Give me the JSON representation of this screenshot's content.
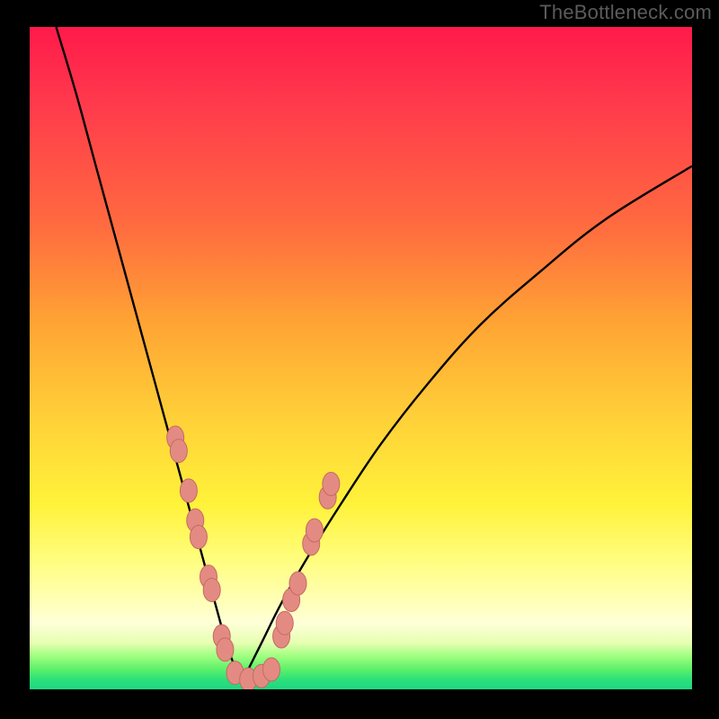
{
  "watermark": "TheBottleneck.com",
  "chart_data": {
    "type": "line",
    "title": "",
    "xlabel": "",
    "ylabel": "",
    "xlim": [
      0,
      100
    ],
    "ylim": [
      0,
      100
    ],
    "grid": false,
    "legend": false,
    "notes": "V-shaped bottleneck curve over vertical red→yellow→green gradient. Y encodes mismatch (higher = worse). Minimum near x≈32. Left branch descends steeply from top-left; right branch rises toward upper-right with decreasing slope. Salmon oval markers cluster along both branches near the trough.",
    "left_branch": {
      "x": [
        4,
        7,
        10,
        13,
        16,
        19,
        22,
        25,
        28,
        30,
        32
      ],
      "y": [
        100,
        90,
        79,
        68,
        57,
        46,
        35,
        24,
        13,
        6,
        1
      ]
    },
    "right_branch": {
      "x": [
        32,
        35,
        38,
        42,
        47,
        53,
        60,
        68,
        77,
        87,
        100
      ],
      "y": [
        1,
        7,
        13,
        20,
        28,
        37,
        46,
        55,
        63,
        71,
        79
      ]
    },
    "markers": [
      {
        "x": 22.0,
        "y": 38.0
      },
      {
        "x": 22.5,
        "y": 36.0
      },
      {
        "x": 24.0,
        "y": 30.0
      },
      {
        "x": 25.0,
        "y": 25.5
      },
      {
        "x": 25.5,
        "y": 23.0
      },
      {
        "x": 27.0,
        "y": 17.0
      },
      {
        "x": 27.5,
        "y": 15.0
      },
      {
        "x": 29.0,
        "y": 8.0
      },
      {
        "x": 29.5,
        "y": 6.0
      },
      {
        "x": 31.0,
        "y": 2.5
      },
      {
        "x": 33.0,
        "y": 1.5
      },
      {
        "x": 35.0,
        "y": 2.0
      },
      {
        "x": 36.5,
        "y": 3.0
      },
      {
        "x": 38.0,
        "y": 8.0
      },
      {
        "x": 38.5,
        "y": 10.0
      },
      {
        "x": 39.5,
        "y": 13.5
      },
      {
        "x": 40.5,
        "y": 16.0
      },
      {
        "x": 42.5,
        "y": 22.0
      },
      {
        "x": 43.0,
        "y": 24.0
      },
      {
        "x": 45.0,
        "y": 29.0
      },
      {
        "x": 45.5,
        "y": 31.0
      }
    ],
    "gradient_stops": [
      {
        "pct": 0,
        "color": "#ff1a4a"
      },
      {
        "pct": 12,
        "color": "#ff3b4c"
      },
      {
        "pct": 30,
        "color": "#ff6b3f"
      },
      {
        "pct": 45,
        "color": "#ffa534"
      },
      {
        "pct": 60,
        "color": "#ffd338"
      },
      {
        "pct": 72,
        "color": "#fff23a"
      },
      {
        "pct": 80,
        "color": "#fffd7a"
      },
      {
        "pct": 86,
        "color": "#ffffb0"
      },
      {
        "pct": 90,
        "color": "#ffffd8"
      },
      {
        "pct": 93,
        "color": "#e6ffb0"
      },
      {
        "pct": 95,
        "color": "#9fff80"
      },
      {
        "pct": 97,
        "color": "#5cf06a"
      },
      {
        "pct": 98.5,
        "color": "#2de07a"
      },
      {
        "pct": 100,
        "color": "#1dd882"
      }
    ],
    "colors": {
      "curve": "#000000",
      "marker_fill": "#e38b83",
      "marker_stroke": "#c46a62",
      "frame": "#000000"
    }
  }
}
